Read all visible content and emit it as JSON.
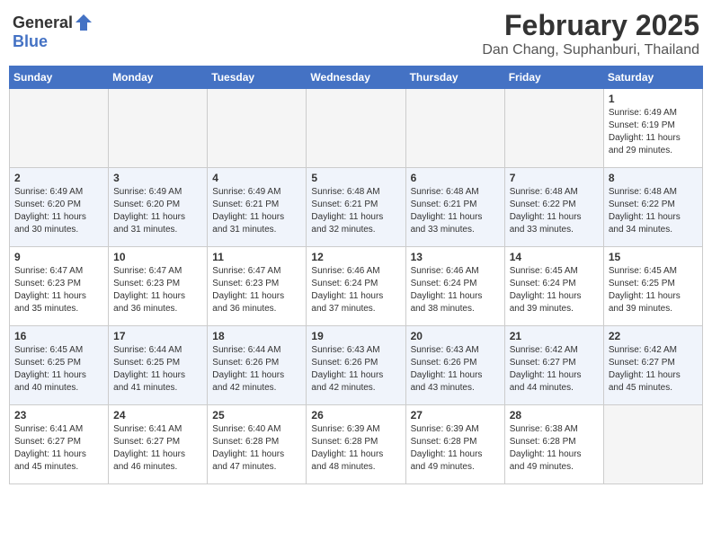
{
  "logo": {
    "general": "General",
    "blue": "Blue"
  },
  "header": {
    "month": "February 2025",
    "location": "Dan Chang, Suphanburi, Thailand"
  },
  "weekdays": [
    "Sunday",
    "Monday",
    "Tuesday",
    "Wednesday",
    "Thursday",
    "Friday",
    "Saturday"
  ],
  "weeks": [
    [
      {
        "day": "",
        "info": ""
      },
      {
        "day": "",
        "info": ""
      },
      {
        "day": "",
        "info": ""
      },
      {
        "day": "",
        "info": ""
      },
      {
        "day": "",
        "info": ""
      },
      {
        "day": "",
        "info": ""
      },
      {
        "day": "1",
        "info": "Sunrise: 6:49 AM\nSunset: 6:19 PM\nDaylight: 11 hours and 29 minutes."
      }
    ],
    [
      {
        "day": "2",
        "info": "Sunrise: 6:49 AM\nSunset: 6:20 PM\nDaylight: 11 hours and 30 minutes."
      },
      {
        "day": "3",
        "info": "Sunrise: 6:49 AM\nSunset: 6:20 PM\nDaylight: 11 hours and 31 minutes."
      },
      {
        "day": "4",
        "info": "Sunrise: 6:49 AM\nSunset: 6:21 PM\nDaylight: 11 hours and 31 minutes."
      },
      {
        "day": "5",
        "info": "Sunrise: 6:48 AM\nSunset: 6:21 PM\nDaylight: 11 hours and 32 minutes."
      },
      {
        "day": "6",
        "info": "Sunrise: 6:48 AM\nSunset: 6:21 PM\nDaylight: 11 hours and 33 minutes."
      },
      {
        "day": "7",
        "info": "Sunrise: 6:48 AM\nSunset: 6:22 PM\nDaylight: 11 hours and 33 minutes."
      },
      {
        "day": "8",
        "info": "Sunrise: 6:48 AM\nSunset: 6:22 PM\nDaylight: 11 hours and 34 minutes."
      }
    ],
    [
      {
        "day": "9",
        "info": "Sunrise: 6:47 AM\nSunset: 6:23 PM\nDaylight: 11 hours and 35 minutes."
      },
      {
        "day": "10",
        "info": "Sunrise: 6:47 AM\nSunset: 6:23 PM\nDaylight: 11 hours and 36 minutes."
      },
      {
        "day": "11",
        "info": "Sunrise: 6:47 AM\nSunset: 6:23 PM\nDaylight: 11 hours and 36 minutes."
      },
      {
        "day": "12",
        "info": "Sunrise: 6:46 AM\nSunset: 6:24 PM\nDaylight: 11 hours and 37 minutes."
      },
      {
        "day": "13",
        "info": "Sunrise: 6:46 AM\nSunset: 6:24 PM\nDaylight: 11 hours and 38 minutes."
      },
      {
        "day": "14",
        "info": "Sunrise: 6:45 AM\nSunset: 6:24 PM\nDaylight: 11 hours and 39 minutes."
      },
      {
        "day": "15",
        "info": "Sunrise: 6:45 AM\nSunset: 6:25 PM\nDaylight: 11 hours and 39 minutes."
      }
    ],
    [
      {
        "day": "16",
        "info": "Sunrise: 6:45 AM\nSunset: 6:25 PM\nDaylight: 11 hours and 40 minutes."
      },
      {
        "day": "17",
        "info": "Sunrise: 6:44 AM\nSunset: 6:25 PM\nDaylight: 11 hours and 41 minutes."
      },
      {
        "day": "18",
        "info": "Sunrise: 6:44 AM\nSunset: 6:26 PM\nDaylight: 11 hours and 42 minutes."
      },
      {
        "day": "19",
        "info": "Sunrise: 6:43 AM\nSunset: 6:26 PM\nDaylight: 11 hours and 42 minutes."
      },
      {
        "day": "20",
        "info": "Sunrise: 6:43 AM\nSunset: 6:26 PM\nDaylight: 11 hours and 43 minutes."
      },
      {
        "day": "21",
        "info": "Sunrise: 6:42 AM\nSunset: 6:27 PM\nDaylight: 11 hours and 44 minutes."
      },
      {
        "day": "22",
        "info": "Sunrise: 6:42 AM\nSunset: 6:27 PM\nDaylight: 11 hours and 45 minutes."
      }
    ],
    [
      {
        "day": "23",
        "info": "Sunrise: 6:41 AM\nSunset: 6:27 PM\nDaylight: 11 hours and 45 minutes."
      },
      {
        "day": "24",
        "info": "Sunrise: 6:41 AM\nSunset: 6:27 PM\nDaylight: 11 hours and 46 minutes."
      },
      {
        "day": "25",
        "info": "Sunrise: 6:40 AM\nSunset: 6:28 PM\nDaylight: 11 hours and 47 minutes."
      },
      {
        "day": "26",
        "info": "Sunrise: 6:39 AM\nSunset: 6:28 PM\nDaylight: 11 hours and 48 minutes."
      },
      {
        "day": "27",
        "info": "Sunrise: 6:39 AM\nSunset: 6:28 PM\nDaylight: 11 hours and 49 minutes."
      },
      {
        "day": "28",
        "info": "Sunrise: 6:38 AM\nSunset: 6:28 PM\nDaylight: 11 hours and 49 minutes."
      },
      {
        "day": "",
        "info": ""
      }
    ]
  ]
}
